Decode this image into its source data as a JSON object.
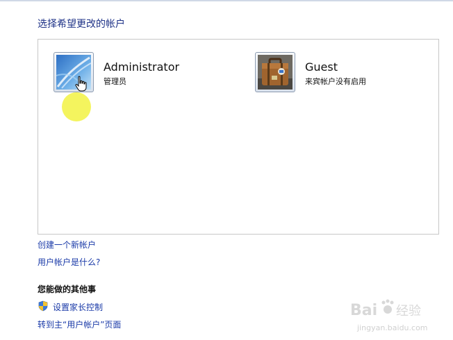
{
  "page": {
    "title": "选择希望更改的帐户"
  },
  "accounts": [
    {
      "name": "Administrator",
      "role": "管理员",
      "avatar_icon": "window-picture-icon"
    },
    {
      "name": "Guest",
      "role": "来宾帐户没有启用",
      "avatar_icon": "suitcase-icon"
    }
  ],
  "links": {
    "create_account": "创建一个新帐户",
    "what_is_account": "用户帐户是什么?"
  },
  "other_tasks": {
    "title": "您能做的其他事",
    "parental_controls": "设置家长控制",
    "main_page": "转到主“用户帐户”页面"
  },
  "watermark": {
    "brand": "Bai",
    "brand_suffix": "经验",
    "url": "jingyan.baidu.com"
  },
  "colors": {
    "title": "#1e3287",
    "link": "#1a3aa8",
    "highlight": "#f0f028"
  }
}
